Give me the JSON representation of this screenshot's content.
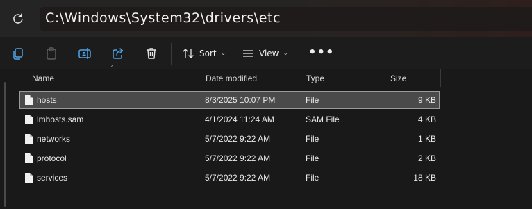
{
  "address": {
    "path": "C:\\Windows\\System32\\drivers\\etc"
  },
  "toolbar": {
    "sort_label": "Sort",
    "view_label": "View",
    "more_label": "•••"
  },
  "columns": {
    "name": "Name",
    "date": "Date modified",
    "type": "Type",
    "size": "Size"
  },
  "files": [
    {
      "name": "hosts",
      "date": "8/3/2025 10:07 PM",
      "type": "File",
      "size": "9 KB",
      "selected": true
    },
    {
      "name": "lmhosts.sam",
      "date": "4/1/2024 11:24 AM",
      "type": "SAM File",
      "size": "4 KB",
      "selected": false
    },
    {
      "name": "networks",
      "date": "5/7/2022 9:22 AM",
      "type": "File",
      "size": "1 KB",
      "selected": false
    },
    {
      "name": "protocol",
      "date": "5/7/2022 9:22 AM",
      "type": "File",
      "size": "2 KB",
      "selected": false
    },
    {
      "name": "services",
      "date": "5/7/2022 9:22 AM",
      "type": "File",
      "size": "18 KB",
      "selected": false
    }
  ],
  "colors": {
    "accent": "#4fa3e8",
    "background": "#191919",
    "selection": "#4a4a4a"
  }
}
